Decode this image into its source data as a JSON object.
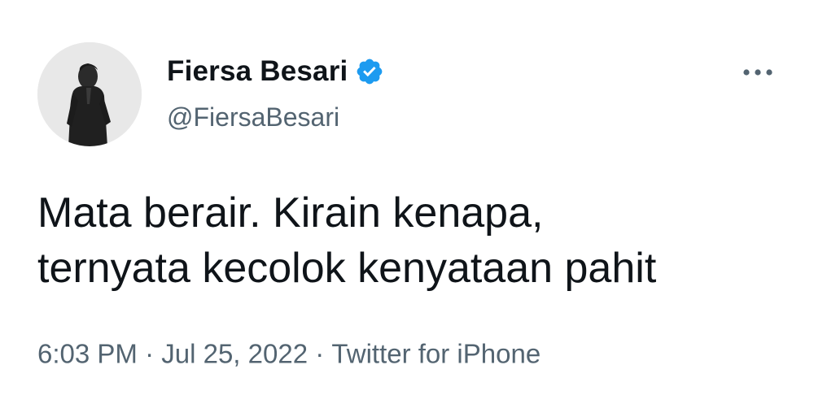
{
  "author": {
    "display_name": "Fiersa Besari",
    "handle": "@FiersaBesari",
    "verified_icon": "verified-badge-icon",
    "avatar_icon": "profile-photo"
  },
  "menu": {
    "icon": "more-options-icon"
  },
  "tweet": {
    "line1": "Mata berair. Kirain kenapa,",
    "line2": "ternyata kecolok kenyataan pahit"
  },
  "meta": {
    "time": "6:03 PM",
    "sep1": "·",
    "date": "Jul 25, 2022",
    "sep2": "·",
    "source": "Twitter for iPhone"
  },
  "colors": {
    "primary_text": "#0f1419",
    "secondary_text": "#536471",
    "verified_blue": "#1d9bf0",
    "background": "#ffffff"
  }
}
